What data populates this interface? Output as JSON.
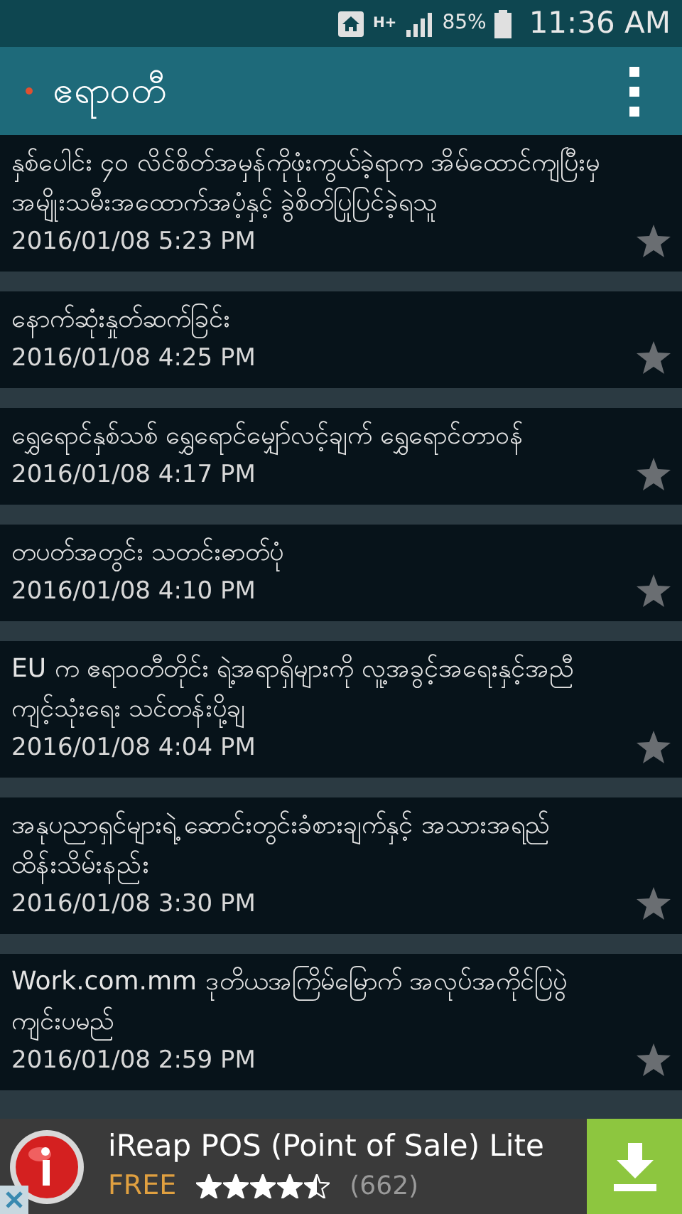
{
  "status_bar": {
    "network": "H+",
    "battery": "85%",
    "time": "11:36 AM"
  },
  "app_bar": {
    "title": "ဧရာဝတီ"
  },
  "articles": [
    {
      "title": "နှစ်ပေါင်း ၄၀ လိင်စိတ်အမှန်ကိုဖုံးကွယ်ခဲ့ရာက အိမ်ထောင်ကျပြီးမှ အမျိုးသမီးအထောက်အပံ့နှင့် ခွဲစိတ်ပြုပြင်ခဲ့ရသူ",
      "date": "2016/01/08 5:23 PM",
      "starred": false
    },
    {
      "title": "နောက်ဆုံးနှုတ်ဆက်ခြင်း",
      "date": "2016/01/08 4:25 PM",
      "starred": false
    },
    {
      "title": "ရွှေရောင်နှစ်သစ် ရွှေရောင်မျှော်လင့်ချက် ရွှေရောင်တာဝန်",
      "date": "2016/01/08 4:17 PM",
      "starred": false
    },
    {
      "title": "တပတ်အတွင်း သတင်းဓာတ်ပုံ",
      "date": "2016/01/08 4:10 PM",
      "starred": false
    },
    {
      "title": "EU က ဧရာဝတီတိုင်း ရဲ့အရာရှိများကို လူ့အခွင့်အရေးနှင့်အညီ ကျင့်သုံးရေး သင်တန်းပို့ချ",
      "date": "2016/01/08 4:04 PM",
      "starred": false
    },
    {
      "title": "အနုပညာရှင်များရဲ့ ဆောင်းတွင်းခံစားချက်နှင့် အသားအရည်ထိန်းသိမ်းနည်း",
      "date": "2016/01/08 3:30 PM",
      "starred": false
    },
    {
      "title": "Work.com.mm ဒုတိယအကြိမ်မြောက် အလုပ်အကိုင်ပြပွဲ ကျင်းပမည်",
      "date": "2016/01/08 2:59 PM",
      "starred": false
    }
  ],
  "ad": {
    "title": "iReap POS (Point of Sale) Lite",
    "price": "FREE",
    "stars": 4.5,
    "count": "(662)"
  }
}
